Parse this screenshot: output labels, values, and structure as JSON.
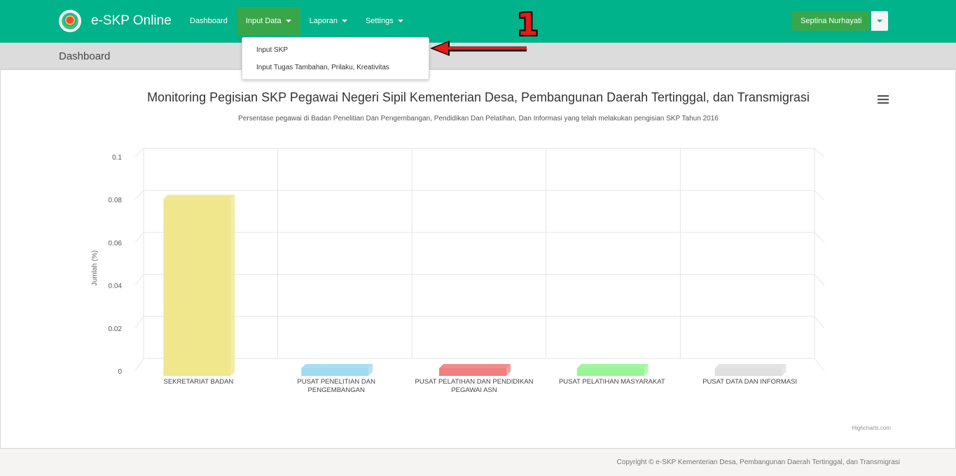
{
  "brand": {
    "title": "e-SKP Online"
  },
  "nav": {
    "items": [
      {
        "label": "Dashboard"
      },
      {
        "label": "Input Data"
      },
      {
        "label": "Laporan"
      },
      {
        "label": "Settings"
      }
    ]
  },
  "user": {
    "name": "Septina Nurhayati"
  },
  "page": {
    "title": "Dashboard"
  },
  "dropdown": {
    "items": [
      {
        "label": "Input SKP"
      },
      {
        "label": "Input Tugas Tambahan, Prilaku, Kreativitas"
      }
    ]
  },
  "annotation": {
    "number": "1"
  },
  "chart_data": {
    "type": "bar",
    "title": "Monitoring Pegisian SKP Pegawai Negeri Sipil Kementerian Desa, Pembangunan Daerah Tertinggal, dan Transmigrasi",
    "subtitle": "Persentase pegawai di Badan Penelitian Dan Pengembangan, Pendidikan Dan Pelatihan, Dan Informasi yang telah melakukan pengisian SKP Tahun 2016",
    "ylabel": "Jumlah (%)",
    "xlabel": "",
    "ylim": [
      0,
      0.1
    ],
    "y_ticks": [
      "0",
      "0.02",
      "0.04",
      "0.06",
      "0.08",
      "0.1"
    ],
    "categories": [
      "SEKRETARIAT BADAN",
      "PUSAT PENELITIAN DAN PENGEMBANGAN",
      "PUSAT PELATIHAN DAN PENDIDIKAN PEGAWAI ASN",
      "PUSAT PELATIHAN MASYARAKAT",
      "PUSAT DATA DAN INFORMASI"
    ],
    "category_lines": [
      [
        "SEKRETARIAT BADAN"
      ],
      [
        "PUSAT PENELITIAN DAN",
        "PENGEMBANGAN"
      ],
      [
        "PUSAT PELATIHAN DAN PENDIDIKAN",
        "PEGAWAI ASN"
      ],
      [
        "PUSAT PELATIHAN MASYARAKAT"
      ],
      [
        "PUSAT DATA DAN INFORMASI"
      ]
    ],
    "values": [
      0.079,
      0,
      0,
      0,
      0
    ],
    "colors": [
      "#f0e68c",
      "#a0daf0",
      "#f08080",
      "#98f598",
      "#e0e0e0"
    ],
    "grid": true,
    "credits": "Highcharts.com"
  },
  "footer": {
    "text": "Copyright © e-SKP Kementerian Desa, Pembangunan Daerah Tertinggal, dan Transmigrasi"
  }
}
